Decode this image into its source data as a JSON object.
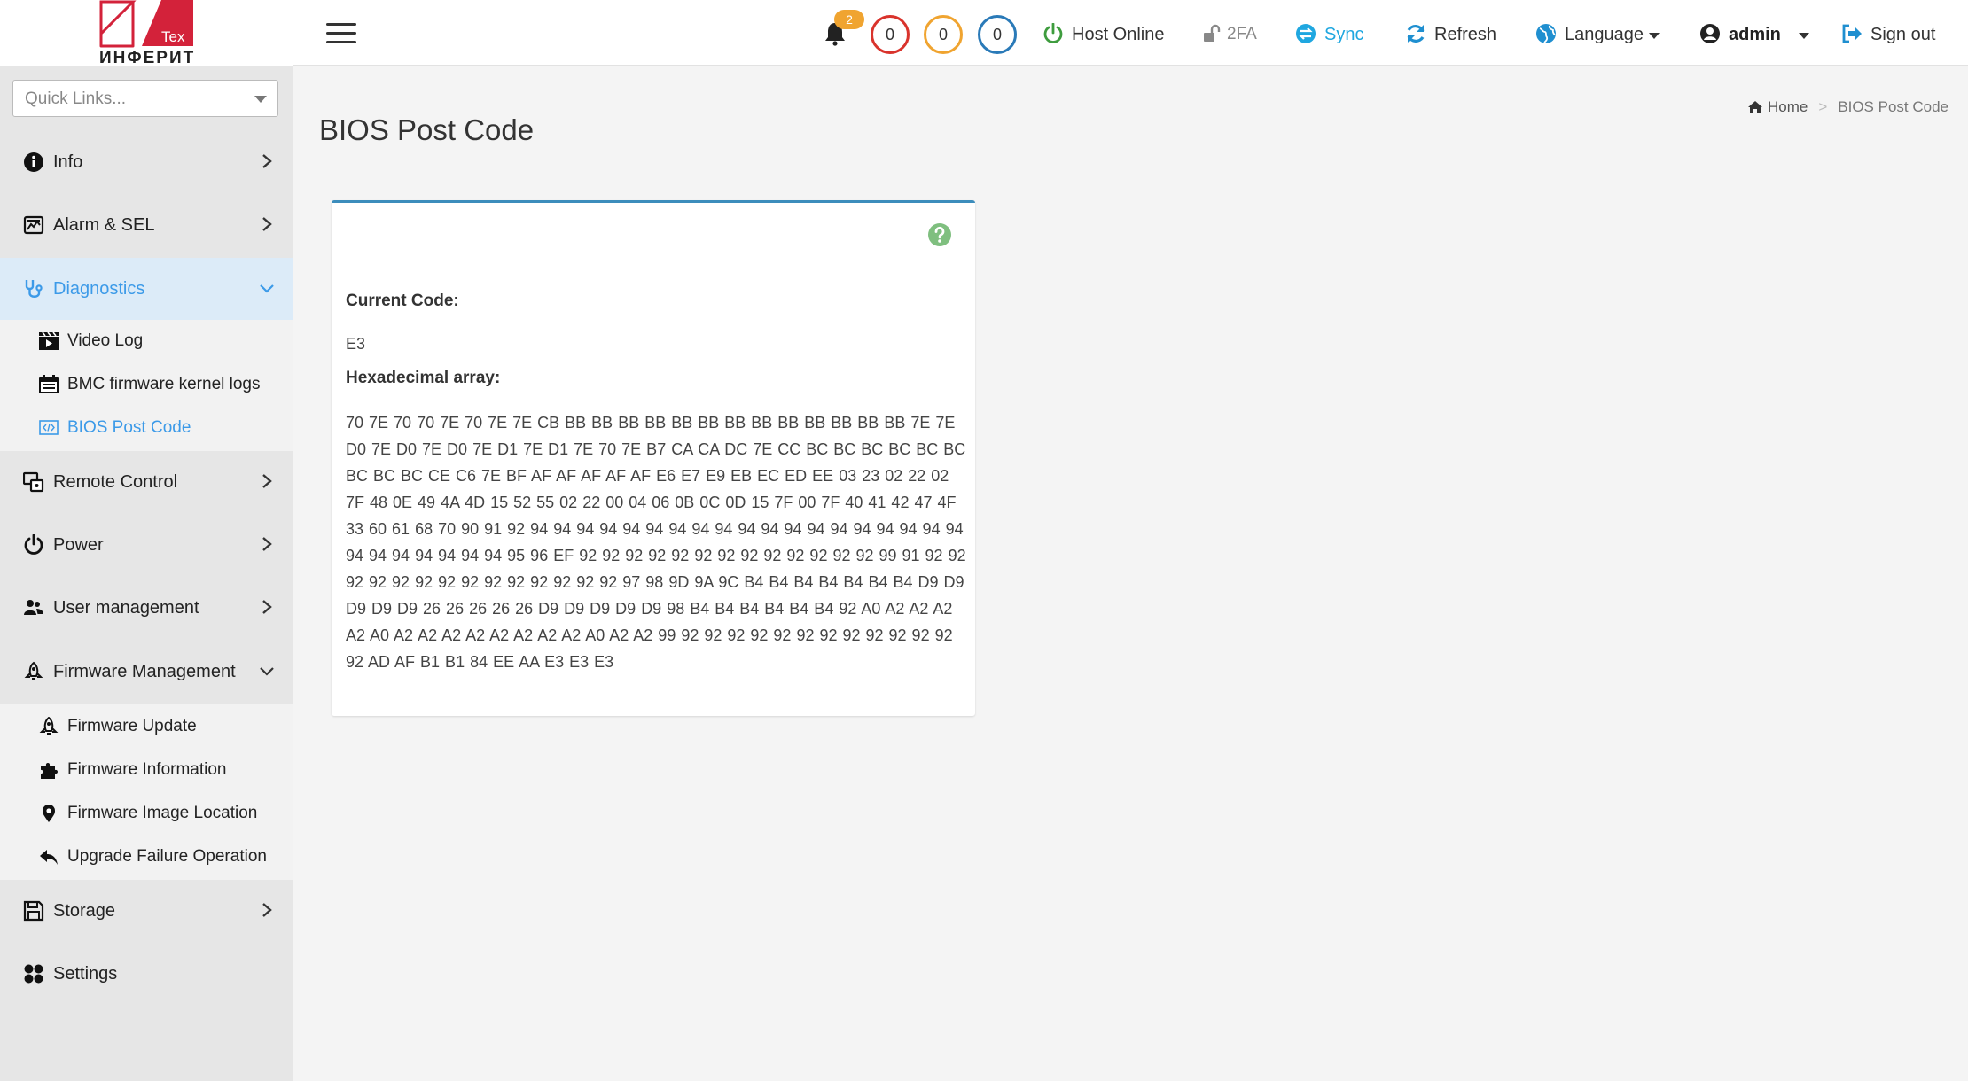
{
  "brand": {
    "badge": "Tex",
    "name": "ИНФЕРИТ",
    "colors": {
      "red": "#d3223a",
      "dark": "#222222"
    }
  },
  "sidebar": {
    "quick_links_placeholder": "Quick Links...",
    "items": [
      {
        "label": "Info",
        "icon": "info-circle-icon",
        "chevron": "right"
      },
      {
        "label": "Alarm & SEL",
        "icon": "alarm-log-icon",
        "chevron": "right"
      },
      {
        "label": "Diagnostics",
        "icon": "stethoscope-icon",
        "chevron": "down",
        "active": true,
        "children": [
          {
            "label": "Video Log",
            "icon": "video-clapper-icon"
          },
          {
            "label": "BMC firmware kernel logs",
            "icon": "calendar-icon"
          },
          {
            "label": "BIOS Post Code",
            "icon": "code-box-icon",
            "active": true
          }
        ]
      },
      {
        "label": "Remote Control",
        "icon": "remote-control-icon",
        "chevron": "right"
      },
      {
        "label": "Power",
        "icon": "power-icon",
        "chevron": "right"
      },
      {
        "label": "User management",
        "icon": "users-icon",
        "chevron": "right"
      },
      {
        "label": "Firmware Management",
        "icon": "rocket-icon",
        "chevron": "down",
        "children": [
          {
            "label": "Firmware Update",
            "icon": "rocket-icon"
          },
          {
            "label": "Firmware Information",
            "icon": "puzzle-icon"
          },
          {
            "label": "Firmware Image Location",
            "icon": "map-pin-icon"
          },
          {
            "label": "Upgrade Failure Operation",
            "icon": "reply-arrow-icon"
          }
        ]
      },
      {
        "label": "Storage",
        "icon": "floppy-disk-icon",
        "chevron": "right"
      },
      {
        "label": "Settings",
        "icon": "settings-grid-icon",
        "chevron": "none"
      }
    ]
  },
  "header": {
    "notification_count": "2",
    "events": {
      "critical": "0",
      "warning": "0",
      "info": "0"
    },
    "host_status": "Host Online",
    "twofa": "2FA",
    "sync": "Sync",
    "refresh": "Refresh",
    "language": "Language",
    "user": "admin",
    "sign_out": "Sign out",
    "colors": {
      "critical": "#d9332c",
      "warning": "#f0a430",
      "info": "#2a7ab8",
      "online": "#3e9c3e",
      "sync": "#1fa7e0",
      "refresh": "#1f8fd0"
    }
  },
  "breadcrumb": {
    "home": "Home",
    "current": "BIOS Post Code"
  },
  "page": {
    "title": "BIOS Post Code",
    "current_code_label": "Current Code:",
    "current_code": "E3",
    "hex_label": "Hexadecimal array:",
    "hex_array": "70 7E 70 70 7E 70 7E 7E CB BB BB BB BB BB BB BB BB BB BB BB BB BB 7E 7E D0 7E D0 7E D0 7E D1 7E D1 7E 70 7E B7 CA CA DC 7E CC BC BC BC BC BC BC BC BC BC CE C6 7E BF AF AF AF AF AF E6 E7 E9 EB EC ED EE 03 23 02 22 02 7F 48 0E 49 4A 4D 15 52 55 02 22 00 04 06 0B 0C 0D 15 7F 00 7F 40 41 42 47 4F 33 60 61 68 70 90 91 92 94 94 94 94 94 94 94 94 94 94 94 94 94 94 94 94 94 94 94 94 94 94 94 94 94 94 95 96 EF 92 92 92 92 92 92 92 92 92 92 92 92 92 99 91 92 92 92 92 92 92 92 92 92 92 92 92 92 92 97 98 9D 9A 9C B4 B4 B4 B4 B4 B4 B4 D9 D9 D9 D9 D9 26 26 26 26 26 D9 D9 D9 D9 D9 98 B4 B4 B4 B4 B4 B4 92 A0 A2 A2 A2 A2 A0 A2 A2 A2 A2 A2 A2 A2 A2 A0 A2 A2 99 92 92 92 92 92 92 92 92 92 92 92 92 92 AD AF B1 B1 84 EE AA E3 E3 E3"
  }
}
